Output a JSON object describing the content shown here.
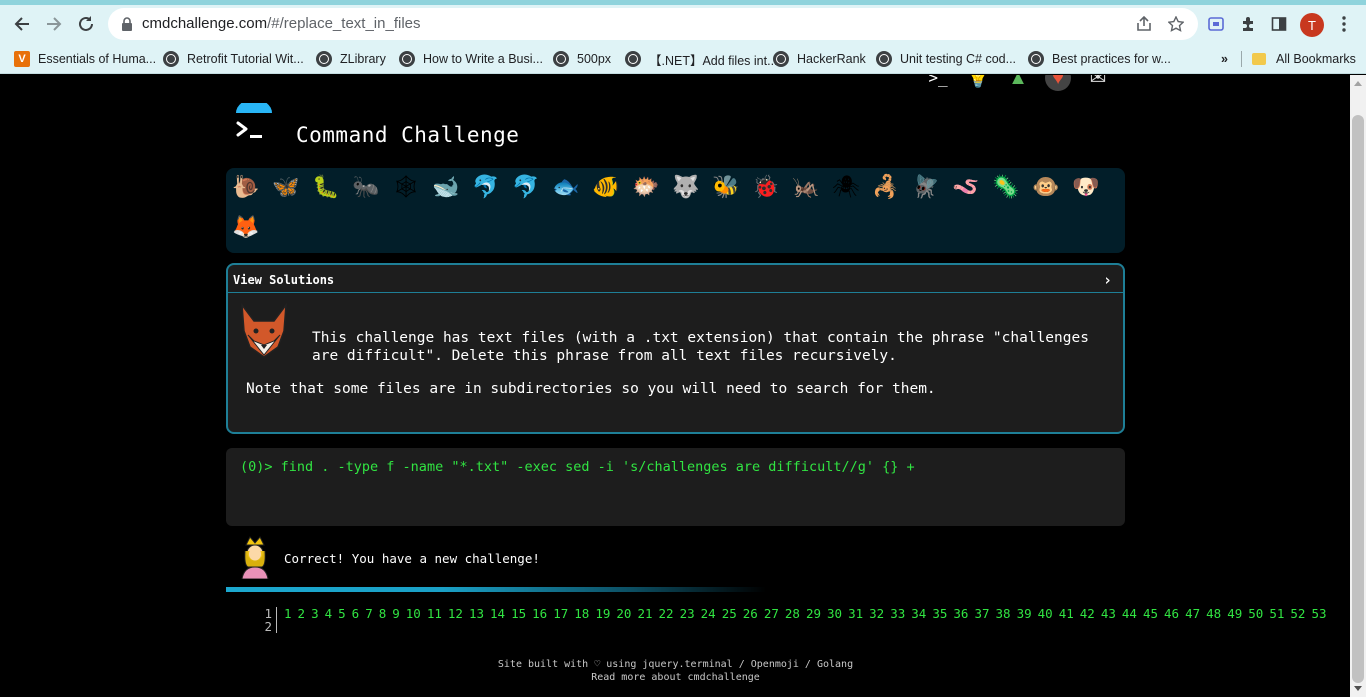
{
  "browser": {
    "url_host": "cmdchallenge.com",
    "url_path": "/#/replace_text_in_files",
    "profile_initial": "T",
    "bookmarks": [
      {
        "label": "Essentials of Huma...",
        "icon": "v-brand-icon"
      },
      {
        "label": "Retrofit Tutorial Wit...",
        "icon": "globe-icon"
      },
      {
        "label": "ZLibrary",
        "icon": "globe-icon"
      },
      {
        "label": "How to Write a Busi...",
        "icon": "globe-icon"
      },
      {
        "label": "500px",
        "icon": "globe-icon"
      },
      {
        "label": "【.NET】Add files int...",
        "icon": "globe-icon"
      },
      {
        "label": "HackerRank",
        "icon": "globe-icon"
      },
      {
        "label": "Unit testing C# cod...",
        "icon": "globe-icon"
      },
      {
        "label": "Best practices for w...",
        "icon": "globe-icon"
      }
    ],
    "overflow_label": "»",
    "all_bookmarks_label": "All Bookmarks"
  },
  "site": {
    "title": "Command Challenge"
  },
  "emojis": [
    "🐌",
    "🦋",
    "🐛",
    "🐜",
    "🕸",
    "🐋",
    "🐬",
    "🐬",
    "🐟",
    "🐠",
    "🐡",
    "🐺",
    "🐝",
    "🐞",
    "🦗",
    "🕷",
    "🦂",
    "🪰",
    "🪱",
    "🦠",
    "🐵",
    "🐶",
    "🦊"
  ],
  "challenge": {
    "view_solutions_label": "View Solutions",
    "chevron": "›",
    "description": "This challenge has text files (with a .txt extension) that contain the phrase \"challenges are difficult\". Delete this phrase from all text files recursively.",
    "note": "Note that some files are in subdirectories so you will need to search for them."
  },
  "terminal": {
    "prompt": "(0)> ",
    "command": "find . -type f -name \"*.txt\" -exec sed -i 's/challenges are difficult//g' {} +"
  },
  "result": {
    "message": "Correct! You have a new challenge!"
  },
  "progress": {
    "fraction": 0.4
  },
  "levels": {
    "line_numbers": [
      "1",
      "2"
    ],
    "items": [
      "1",
      "2",
      "3",
      "4",
      "5",
      "6",
      "7",
      "8",
      "9",
      "10",
      "11",
      "12",
      "13",
      "14",
      "15",
      "16",
      "17",
      "18",
      "19",
      "20",
      "21",
      "22",
      "23",
      "24",
      "25",
      "26",
      "27",
      "28",
      "29",
      "30",
      "31",
      "32",
      "33",
      "34",
      "35",
      "36",
      "37",
      "38",
      "39",
      "40",
      "41",
      "42",
      "43",
      "44",
      "45",
      "46",
      "47",
      "48",
      "49",
      "50",
      "51",
      "52",
      "53"
    ]
  },
  "footer": {
    "line1": "Site built with ♡ using jquery.terminal / Openmoji / Golang",
    "line2": "Read more about cmdchallenge"
  },
  "colors": {
    "accent": "#1e7f97",
    "terminal_green": "#31e442",
    "panel_bg": "#021e29",
    "box_bg": "#1d1d1d",
    "chrome_bg": "#dff3f6"
  }
}
